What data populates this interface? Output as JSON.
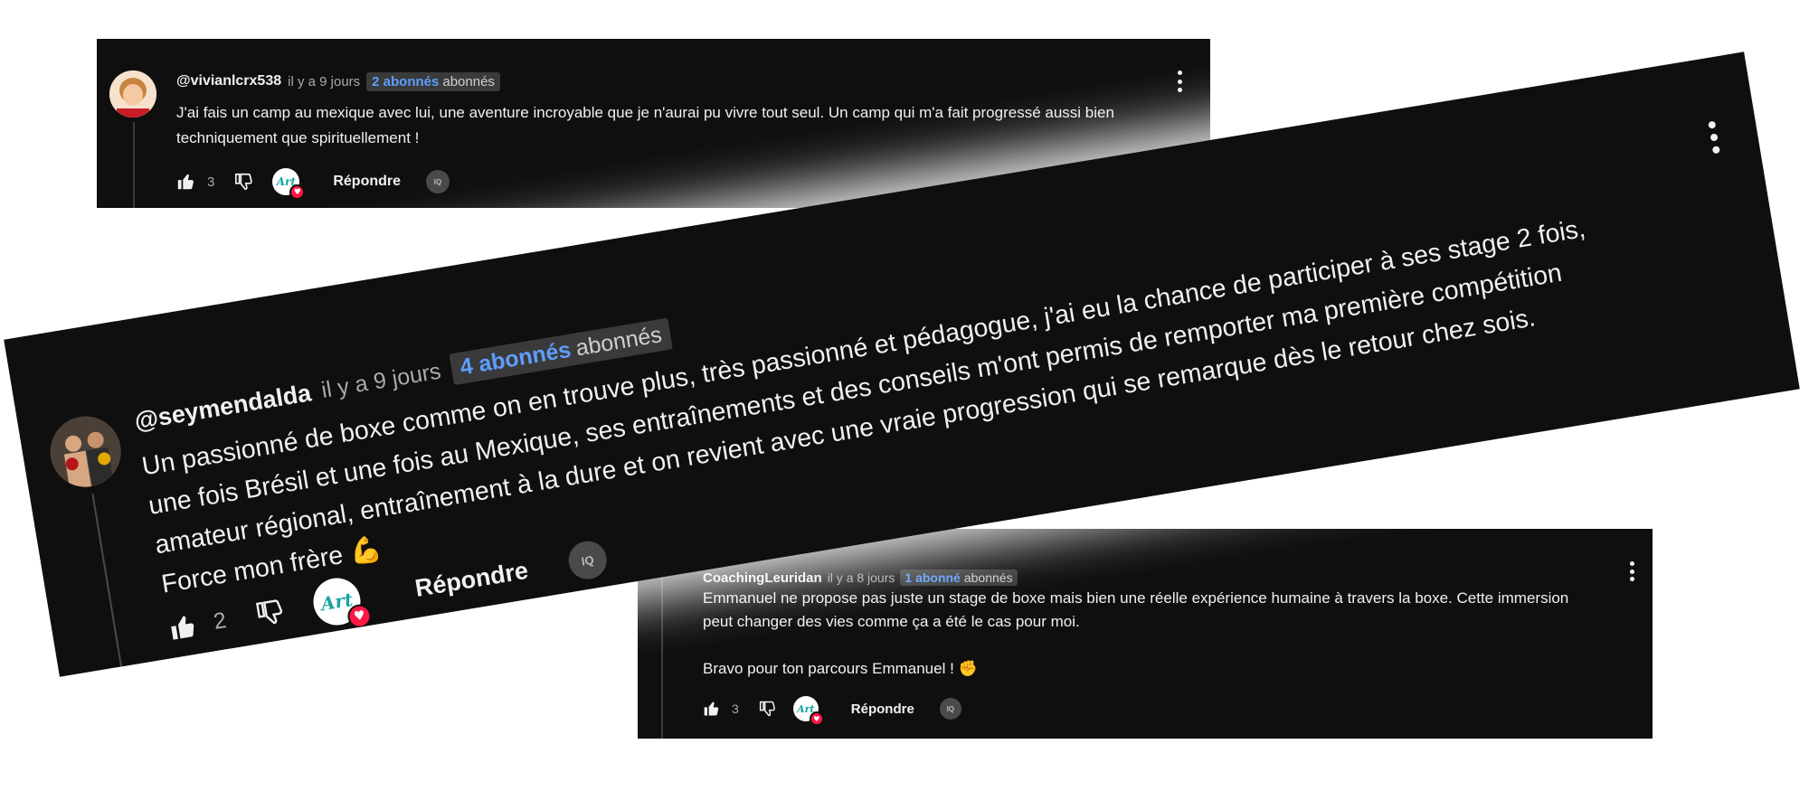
{
  "comments": [
    {
      "author": "@vivianlcrx538",
      "time": "il y a 9 jours",
      "badge_count": "2 abonnés",
      "badge_suffix": "abonnés",
      "text": "J'ai fais un camp au mexique avec lui, une aventure incroyable que je n'aurai pu vivre tout seul. Un camp qui m'a fait progressé aussi bien techniquement que spirituellement !",
      "likes": "3",
      "reply_label": "Répondre",
      "creator_heart_label": "Art",
      "filter_label": "IQ"
    },
    {
      "author": "@seymendalda",
      "time": "il y a 9 jours",
      "badge_count": "4 abonnés",
      "badge_suffix": "abonnés",
      "text_lines": [
        "Un passionné de boxe comme on en trouve plus, très passionné et pédagogue, j'ai eu la chance de participer à ses stage 2 fois,",
        "une fois Brésil et une fois au Mexique, ses entraînements et des conseils m'ont permis de remporter ma première compétition",
        "amateur régional, entraînement à la dure et on revient avec une vraie progression qui se remarque dès le retour chez sois.",
        "Force mon frère 💪"
      ],
      "likes": "2",
      "reply_label": "Répondre",
      "creator_heart_label": "Art",
      "filter_label": "IQ"
    },
    {
      "author": "CoachingLeuridan",
      "time": "il y a 8 jours",
      "badge_count": "1 abonné",
      "badge_suffix": "abonnés",
      "text_lines": [
        "Emmanuel ne propose pas juste un stage de boxe mais bien une réelle expérience humaine à travers la boxe. Cette immersion",
        "peut changer des vies comme ça a été le cas pour moi.",
        "",
        "Bravo pour ton parcours Emmanuel ! ✊"
      ],
      "likes": "3",
      "reply_label": "Répondre",
      "creator_heart_label": "Art",
      "filter_label": "IQ"
    }
  ],
  "icons": [
    "thumbs-up-icon",
    "thumbs-down-icon",
    "more-vert-icon",
    "heart-icon"
  ],
  "colors": {
    "background": "#0f0f0f",
    "text": "#f1f1f1",
    "muted": "#aaaaaa",
    "badge_accent": "#5f9dff",
    "heart": "#ff1744"
  }
}
